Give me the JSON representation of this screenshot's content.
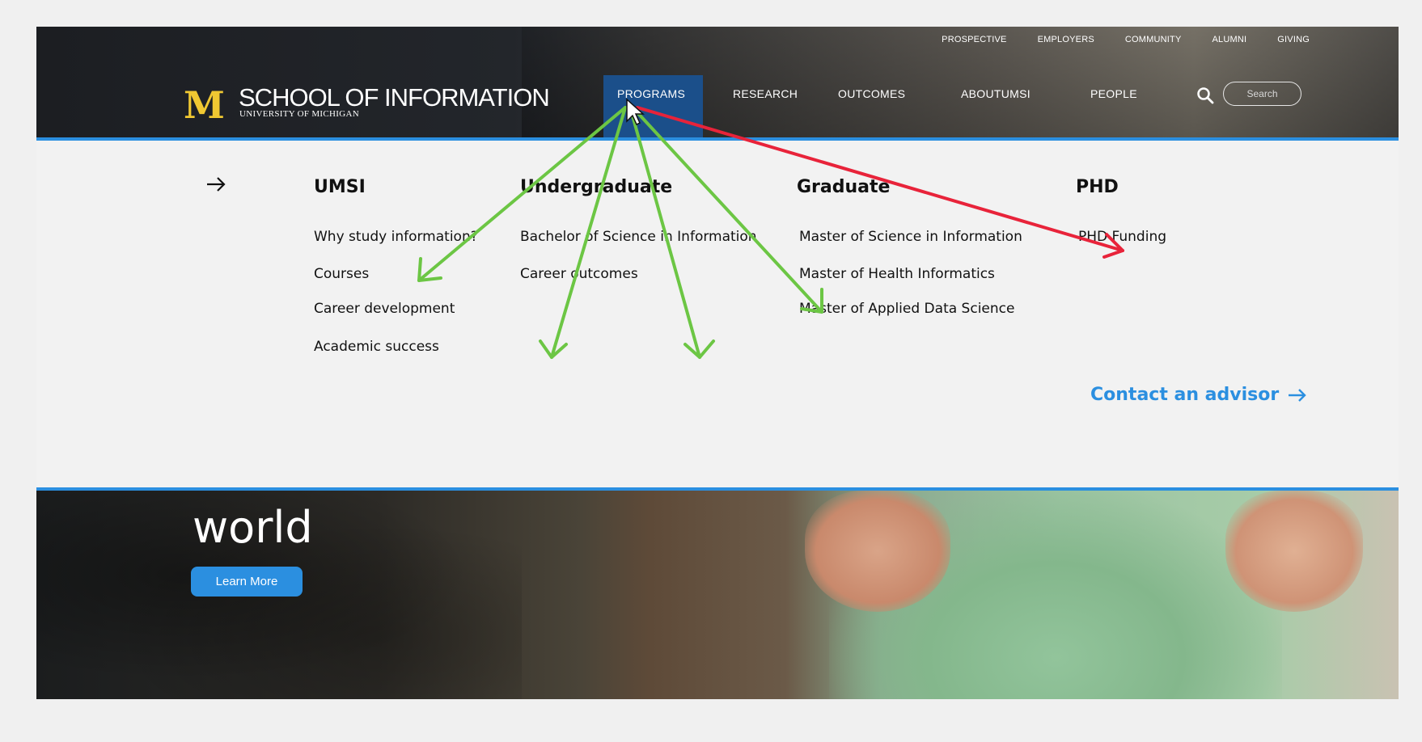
{
  "header": {
    "utility_nav": [
      "PROSPECTIVE",
      "EMPLOYERS",
      "COMMUNITY",
      "ALUMNI",
      "GIVING"
    ],
    "logo": {
      "mark": "M",
      "title": "SCHOOL OF INFORMATION",
      "subtitle": "UNIVERSITY OF MICHIGAN"
    },
    "main_nav": [
      "PROGRAMS",
      "RESEARCH",
      "OUTCOMES",
      "ABOUTUMSI",
      "PEOPLE"
    ],
    "active_nav": "PROGRAMS",
    "search_placeholder": "Search"
  },
  "menu": {
    "columns": [
      {
        "heading": "UMSI",
        "links": [
          "Why study information?",
          "Courses",
          "Career development",
          "Academic success"
        ]
      },
      {
        "heading": "Undergraduate",
        "links": [
          "Bachelor of Science in Information",
          "Career outcomes"
        ]
      },
      {
        "heading": "Graduate",
        "links": [
          "Master of Science in Information",
          "Master of Health Informatics",
          "Master of Applied Data Science"
        ]
      },
      {
        "heading": "PHD",
        "links": [
          "PHD Funding"
        ]
      }
    ],
    "cta": "Contact an advisor"
  },
  "hero": {
    "word": "world",
    "button": "Learn More"
  },
  "colors": {
    "accent": "#2b8fe0",
    "active_nav": "#1b4f8a",
    "maize": "#f0c832",
    "annotation_green": "#6cc644",
    "annotation_red": "#e8233a"
  },
  "icons": {
    "back": "arrow-right-icon",
    "search": "search-icon",
    "cta": "arrow-right-icon"
  }
}
